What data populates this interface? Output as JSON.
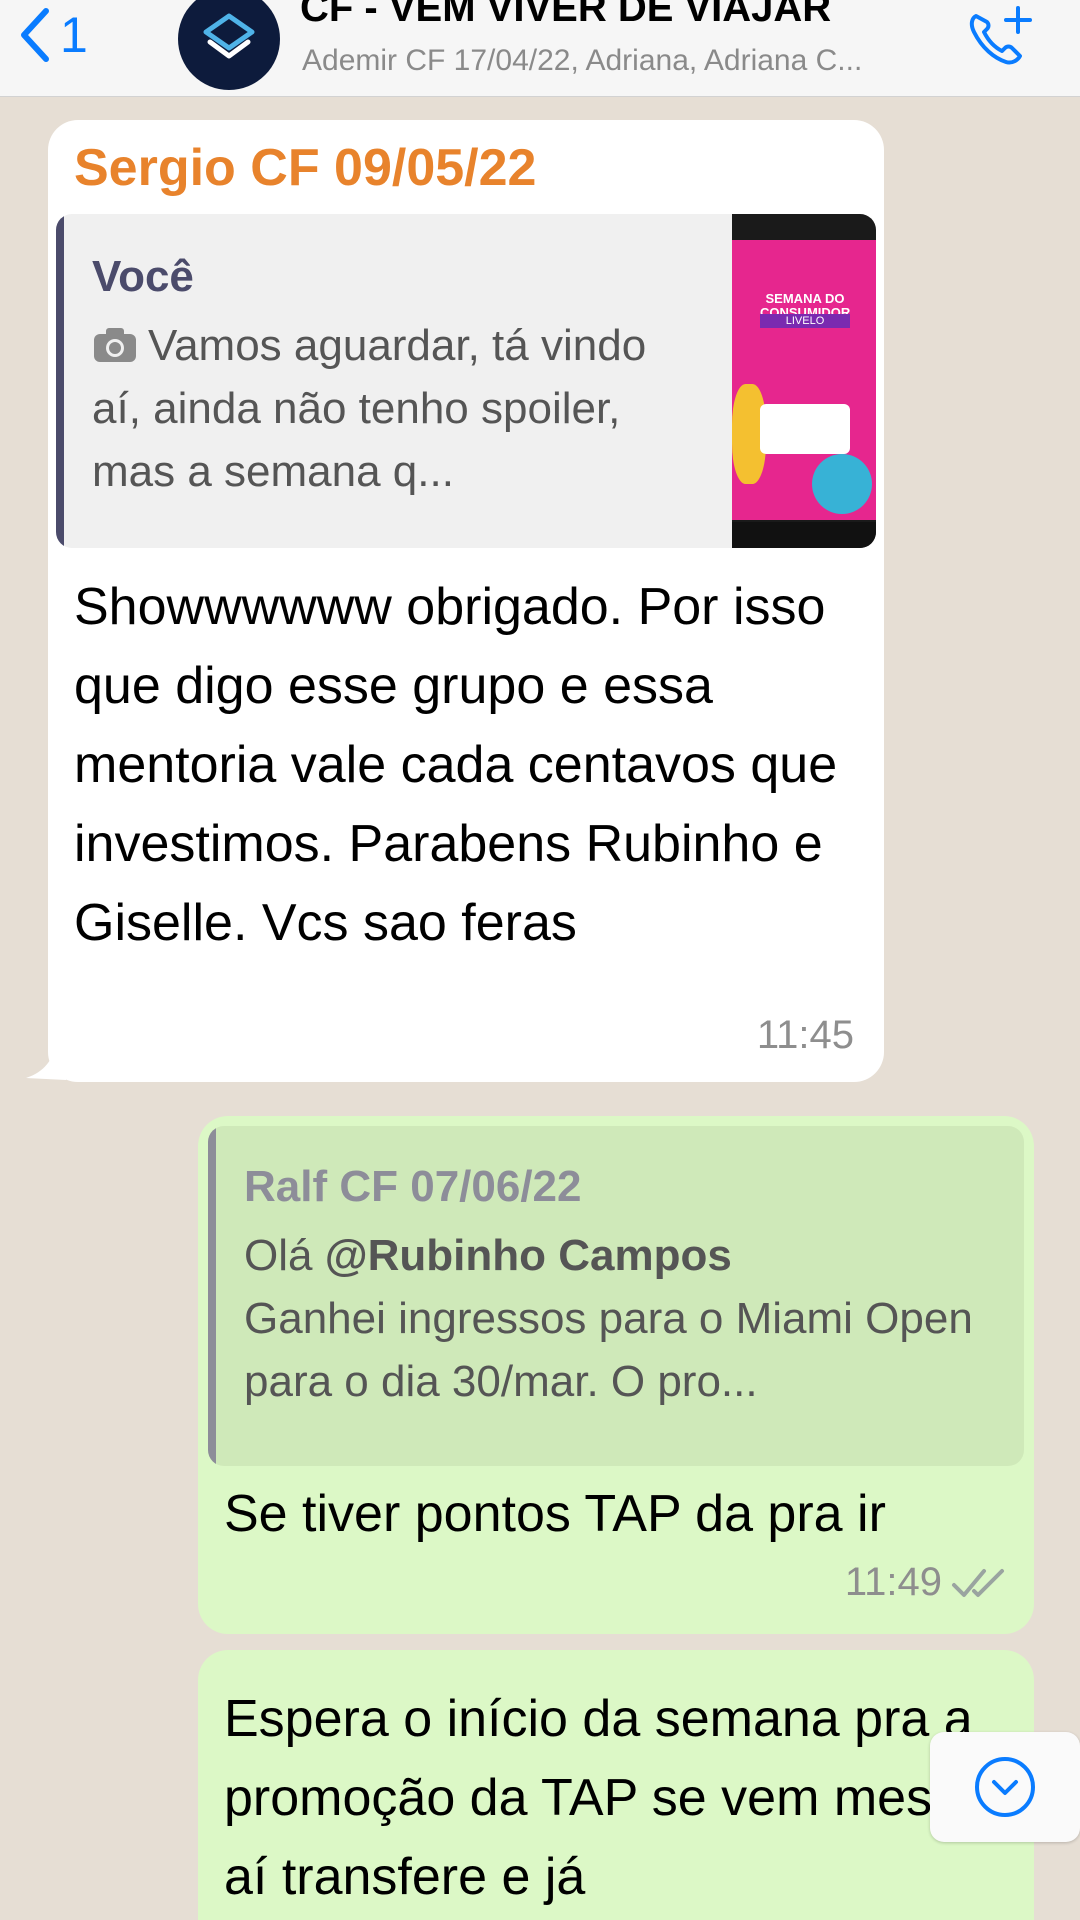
{
  "header": {
    "back_count": "1",
    "title": "CF - VEM VIVER DE VIAJAR",
    "members": "Ademir CF 17/04/22, Adriana, Adriana C...",
    "avatar_icon": "group-logo-icon",
    "call_icon": "add-call-icon"
  },
  "messages": [
    {
      "direction": "incoming",
      "sender": "Sergio CF 09/05/22",
      "sender_color": "#e8832c",
      "quote": {
        "author": "Você",
        "icon": "camera-icon",
        "text": "Vamos aguardar, tá vindo aí, ainda não tenho spoiler, mas a semana q...",
        "thumbnail": {
          "line1": "SEMANA DO CONSUMIDOR",
          "line2": "LIVELO"
        }
      },
      "text": "Showwwwww obrigado. Por isso que digo esse grupo e essa mentoria vale cada centavos que investimos. Parabens Rubinho e Giselle. Vcs sao feras",
      "time": "11:45"
    },
    {
      "direction": "outgoing",
      "quote": {
        "author": "Ralf CF 07/06/22",
        "prefix": "Olá ",
        "mention": "@Rubinho Campos",
        "text": "Ganhei ingressos para o Miami Open para o dia 30/mar. O pro..."
      },
      "text": "Se tiver pontos TAP da pra ir",
      "time": "11:49",
      "status_icon": "read-ticks-icon"
    },
    {
      "direction": "outgoing",
      "text": "Espera o início da semana pra a promoção da TAP se vem mesmo, aí transfere e já"
    }
  ],
  "colors": {
    "incoming_bubble": "#ffffff",
    "outgoing_bubble": "#dcf8c6",
    "accent_blue": "#0a7cff",
    "chat_background": "#e6ded4"
  },
  "scroll_button_icon": "scroll-down-icon"
}
